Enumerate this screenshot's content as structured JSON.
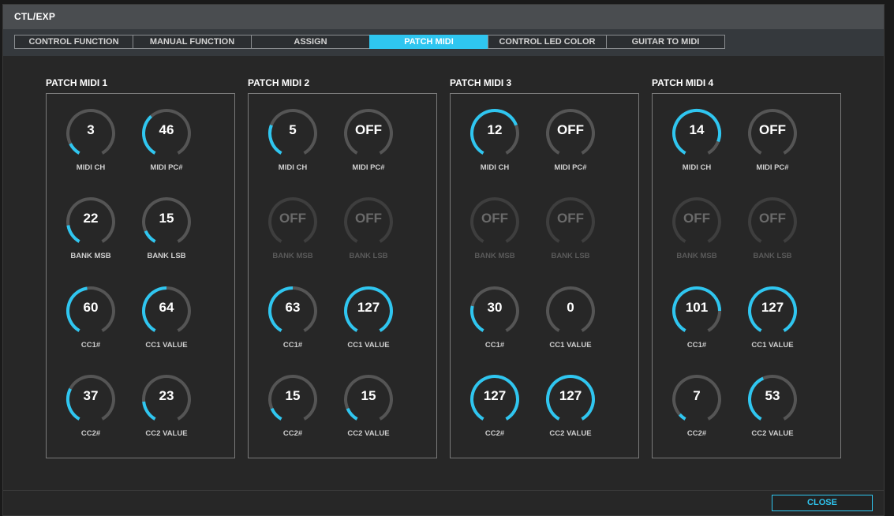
{
  "window": {
    "title": "CTL/EXP"
  },
  "tabs": [
    {
      "label": "CONTROL FUNCTION",
      "active": false
    },
    {
      "label": "MANUAL FUNCTION",
      "active": false
    },
    {
      "label": "ASSIGN",
      "active": false
    },
    {
      "label": "PATCH MIDI",
      "active": true
    },
    {
      "label": "CONTROL LED COLOR",
      "active": false
    },
    {
      "label": "GUITAR TO MIDI",
      "active": false
    }
  ],
  "colors": {
    "accent": "#2fc6f0",
    "track": "#555555",
    "track_disabled": "#3e3e3e"
  },
  "patches": [
    {
      "title": "PATCH MIDI 1",
      "knobs": [
        {
          "label": "MIDI CH",
          "value": "3",
          "fill": 0.11,
          "enabled": true
        },
        {
          "label": "MIDI PC#",
          "value": "46",
          "fill": 0.36,
          "enabled": true
        },
        {
          "label": "BANK MSB",
          "value": "22",
          "fill": 0.17,
          "enabled": true
        },
        {
          "label": "BANK LSB",
          "value": "15",
          "fill": 0.12,
          "enabled": true
        },
        {
          "label": "CC1#",
          "value": "60",
          "fill": 0.47,
          "enabled": true
        },
        {
          "label": "CC1 VALUE",
          "value": "64",
          "fill": 0.5,
          "enabled": true
        },
        {
          "label": "CC2#",
          "value": "37",
          "fill": 0.29,
          "enabled": true
        },
        {
          "label": "CC2 VALUE",
          "value": "23",
          "fill": 0.18,
          "enabled": true
        }
      ]
    },
    {
      "title": "PATCH MIDI 2",
      "knobs": [
        {
          "label": "MIDI CH",
          "value": "5",
          "fill": 0.27,
          "enabled": true
        },
        {
          "label": "MIDI PC#",
          "value": "OFF",
          "fill": 0,
          "enabled": true
        },
        {
          "label": "BANK MSB",
          "value": "OFF",
          "fill": 0,
          "enabled": false
        },
        {
          "label": "BANK LSB",
          "value": "OFF",
          "fill": 0,
          "enabled": false
        },
        {
          "label": "CC1#",
          "value": "63",
          "fill": 0.5,
          "enabled": true
        },
        {
          "label": "CC1 VALUE",
          "value": "127",
          "fill": 1.0,
          "enabled": true
        },
        {
          "label": "CC2#",
          "value": "15",
          "fill": 0.12,
          "enabled": true
        },
        {
          "label": "CC2 VALUE",
          "value": "15",
          "fill": 0.12,
          "enabled": true
        }
      ]
    },
    {
      "title": "PATCH MIDI 3",
      "knobs": [
        {
          "label": "MIDI CH",
          "value": "12",
          "fill": 0.73,
          "enabled": true
        },
        {
          "label": "MIDI PC#",
          "value": "OFF",
          "fill": 0,
          "enabled": true
        },
        {
          "label": "BANK MSB",
          "value": "OFF",
          "fill": 0,
          "enabled": false
        },
        {
          "label": "BANK LSB",
          "value": "OFF",
          "fill": 0,
          "enabled": false
        },
        {
          "label": "CC1#",
          "value": "30",
          "fill": 0.24,
          "enabled": true
        },
        {
          "label": "CC1 VALUE",
          "value": "0",
          "fill": 0,
          "enabled": true
        },
        {
          "label": "CC2#",
          "value": "127",
          "fill": 1.0,
          "enabled": true
        },
        {
          "label": "CC2 VALUE",
          "value": "127",
          "fill": 1.0,
          "enabled": true
        }
      ]
    },
    {
      "title": "PATCH MIDI 4",
      "knobs": [
        {
          "label": "MIDI CH",
          "value": "14",
          "fill": 0.87,
          "enabled": true
        },
        {
          "label": "MIDI PC#",
          "value": "OFF",
          "fill": 0,
          "enabled": true
        },
        {
          "label": "BANK MSB",
          "value": "OFF",
          "fill": 0,
          "enabled": false
        },
        {
          "label": "BANK LSB",
          "value": "OFF",
          "fill": 0,
          "enabled": false
        },
        {
          "label": "CC1#",
          "value": "101",
          "fill": 0.8,
          "enabled": true
        },
        {
          "label": "CC1 VALUE",
          "value": "127",
          "fill": 1.0,
          "enabled": true
        },
        {
          "label": "CC2#",
          "value": "7",
          "fill": 0.06,
          "enabled": true
        },
        {
          "label": "CC2 VALUE",
          "value": "53",
          "fill": 0.42,
          "enabled": true
        }
      ]
    }
  ],
  "footer": {
    "close_label": "CLOSE"
  }
}
